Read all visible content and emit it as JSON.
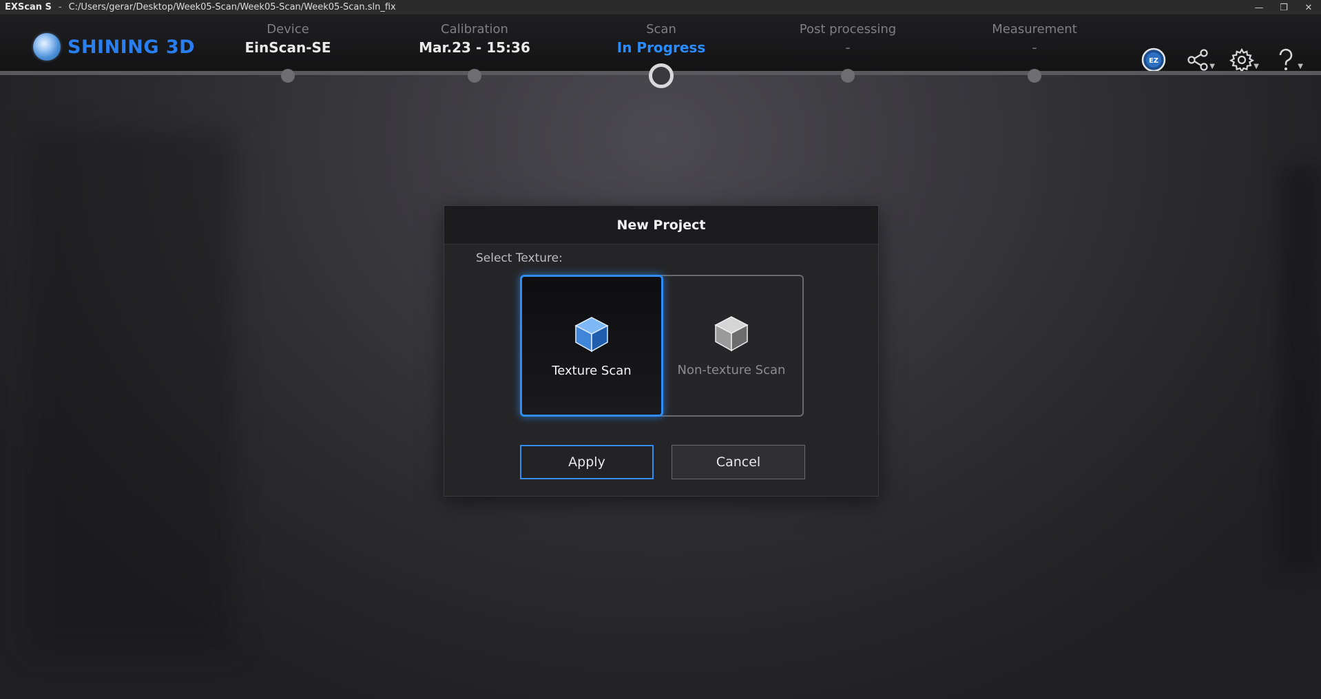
{
  "titlebar": {
    "app": "EXScan S",
    "separator": "-",
    "path": "C:/Users/gerar/Desktop/Week05-Scan/Week05-Scan/Week05-Scan.sln_fix",
    "minimize": "—",
    "restore": "❐",
    "close": "✕"
  },
  "brand": {
    "name": "SHINING 3D"
  },
  "steps": [
    {
      "label": "Device",
      "value": "EinScan-SE",
      "state": "done"
    },
    {
      "label": "Calibration",
      "value": "Mar.23 - 15:36",
      "state": "done"
    },
    {
      "label": "Scan",
      "value": "In Progress",
      "state": "active"
    },
    {
      "label": "Post processing",
      "value": "-",
      "state": "pending"
    },
    {
      "label": "Measurement",
      "value": "-",
      "state": "pending"
    }
  ],
  "toolbar": {
    "icons": [
      "ez-model-icon",
      "share-icon",
      "settings-icon",
      "help-icon"
    ],
    "badge": "EZ"
  },
  "dialog": {
    "title": "New Project",
    "select_label": "Select Texture:",
    "options": [
      {
        "label": "Texture Scan",
        "selected": true
      },
      {
        "label": "Non-texture Scan",
        "selected": false
      }
    ],
    "apply": "Apply",
    "cancel": "Cancel"
  },
  "colors": {
    "accent": "#2f8df5",
    "brand": "#2a7ff0",
    "active_step": "#2a8cff"
  }
}
